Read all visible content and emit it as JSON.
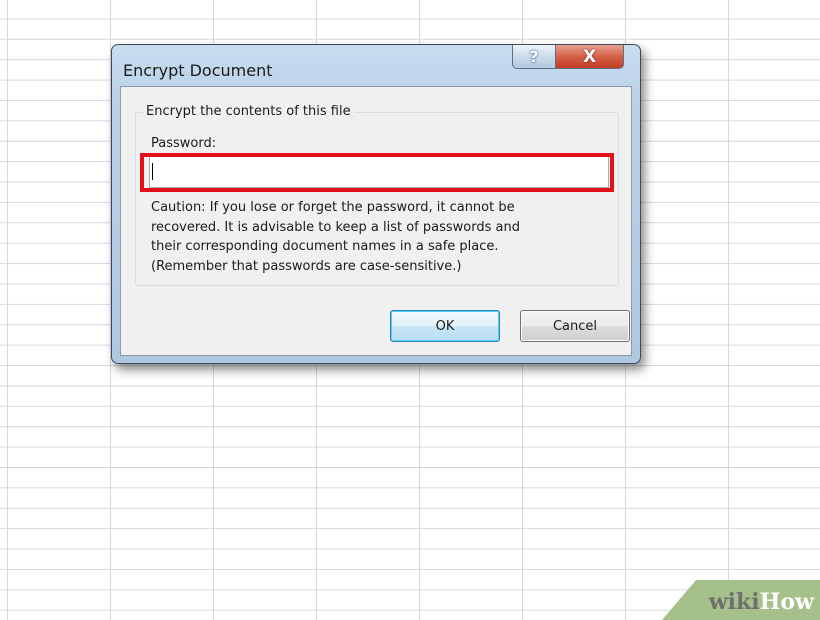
{
  "dialog": {
    "title": "Encrypt Document",
    "help_glyph": "?",
    "close_glyph": "X",
    "group_label": "Encrypt the contents of this file",
    "password_label": "Password:",
    "password_value": "",
    "caution_lines": [
      "Caution: If you lose or forget the password, it cannot be",
      "recovered. It is advisable to keep a list of passwords and",
      "their corresponding document names in a safe place.",
      "(Remember that passwords are case-sensitive.)"
    ],
    "ok_label": "OK",
    "cancel_label": "Cancel"
  },
  "watermark": {
    "part1": "wiki",
    "part2": "How"
  },
  "icons": {
    "help": "help-icon",
    "close": "close-icon"
  },
  "colors": {
    "highlight": "#e1101a",
    "title_bar": "#bad1e8",
    "close_button": "#c23d22",
    "watermark_bg": "#a6c08b"
  }
}
